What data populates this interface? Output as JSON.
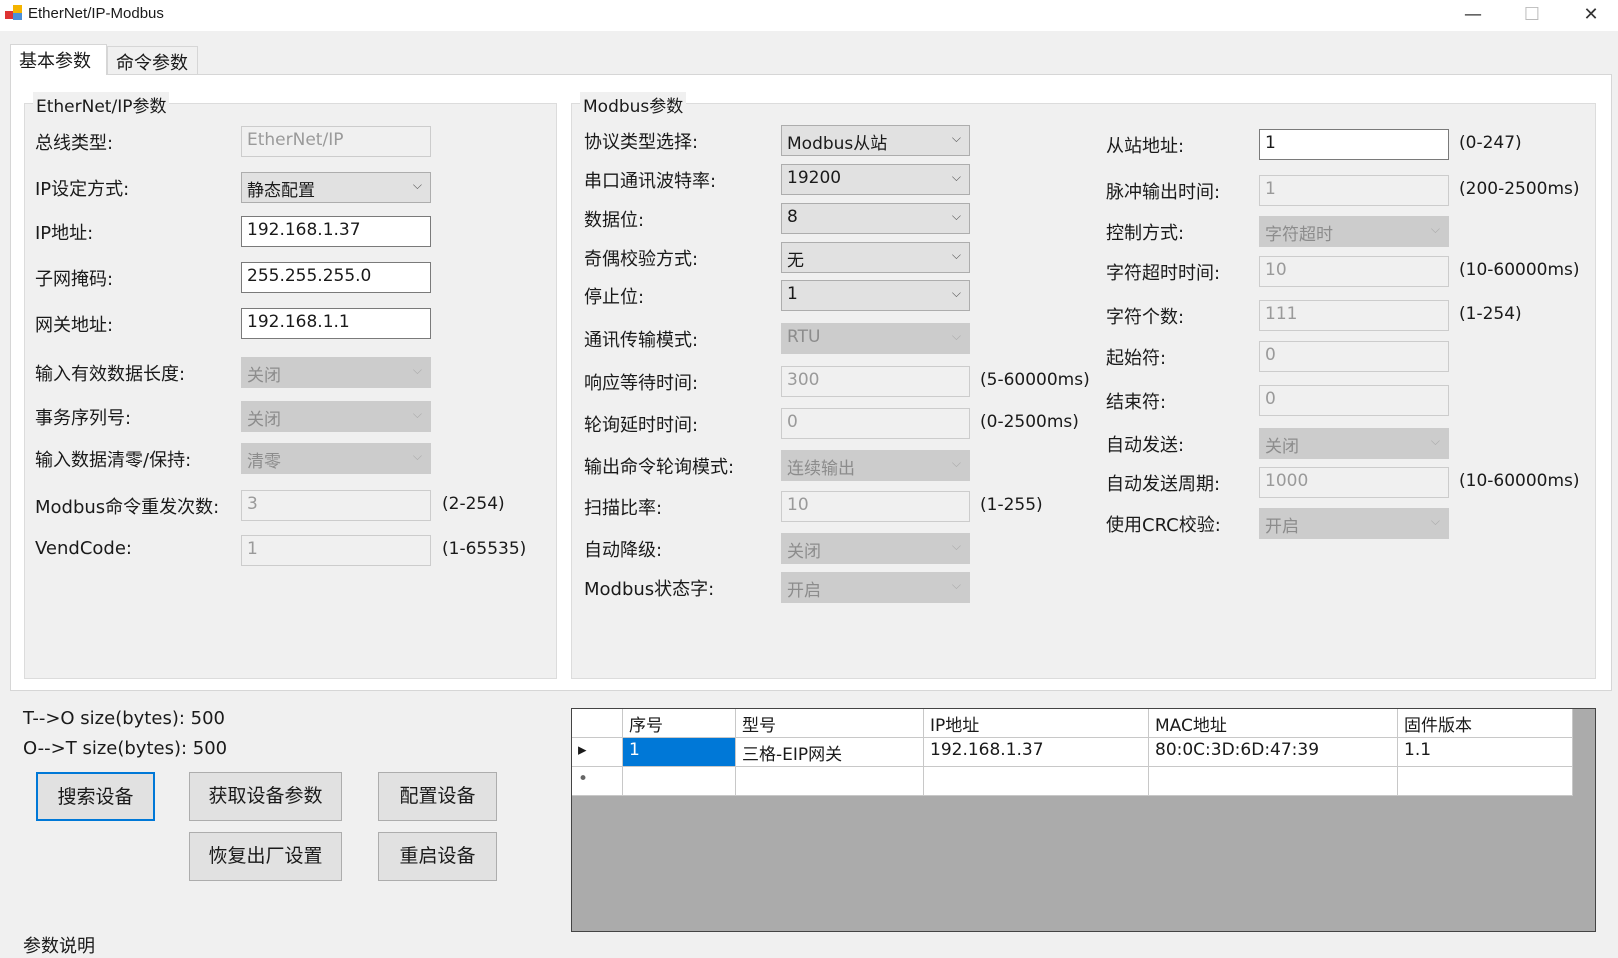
{
  "window": {
    "title": "EtherNet/IP-Modbus",
    "minimize": "—",
    "maximize": "☐",
    "close": "✕"
  },
  "tabs": [
    "基本参数",
    "命令参数"
  ],
  "eip": {
    "title": "EtherNet/IP参数",
    "rows": [
      {
        "label": "总线类型:",
        "value": "EtherNet/IP",
        "kind": "dis"
      },
      {
        "label": "IP设定方式:",
        "value": "静态配置",
        "kind": "sel"
      },
      {
        "label": "IP地址:",
        "value": "192.168.1.37",
        "kind": "txt"
      },
      {
        "label": "子网掩码:",
        "value": "255.255.255.0",
        "kind": "txt"
      },
      {
        "label": "网关地址:",
        "value": "192.168.1.1",
        "kind": "txt"
      },
      {
        "label": "输入有效数据长度:",
        "value": "关闭",
        "kind": "dsel"
      },
      {
        "label": "事务序列号:",
        "value": "关闭",
        "kind": "dsel"
      },
      {
        "label": "输入数据清零/保持:",
        "value": "清零",
        "kind": "dsel"
      },
      {
        "label": "Modbus命令重发次数:",
        "value": "3",
        "kind": "dis",
        "range": "(2-254)"
      },
      {
        "label": "VendCode:",
        "value": "1",
        "kind": "dis",
        "range": "(1-65535)"
      }
    ]
  },
  "modbus": {
    "title": "Modbus参数",
    "left": [
      {
        "label": "协议类型选择:",
        "value": "Modbus从站",
        "kind": "sel"
      },
      {
        "label": "串口通讯波特率:",
        "value": "19200",
        "kind": "sel"
      },
      {
        "label": "数据位:",
        "value": "8",
        "kind": "sel"
      },
      {
        "label": "奇偶校验方式:",
        "value": "无",
        "kind": "sel"
      },
      {
        "label": "停止位:",
        "value": "1",
        "kind": "sel"
      },
      {
        "label": "通讯传输模式:",
        "value": "RTU",
        "kind": "dsel"
      },
      {
        "label": "响应等待时间:",
        "value": "300",
        "kind": "dis",
        "range": "(5-60000ms)"
      },
      {
        "label": "轮询延时时间:",
        "value": "0",
        "kind": "dis",
        "range": "(0-2500ms)"
      },
      {
        "label": "输出命令轮询模式:",
        "value": "连续输出",
        "kind": "dsel"
      },
      {
        "label": "扫描比率:",
        "value": "10",
        "kind": "dis",
        "range": "(1-255)"
      },
      {
        "label": "自动降级:",
        "value": "关闭",
        "kind": "dsel"
      },
      {
        "label": "Modbus状态字:",
        "value": "开启",
        "kind": "dsel"
      }
    ],
    "right": [
      {
        "label": "从站地址:",
        "value": "1",
        "kind": "txt",
        "range": "(0-247)"
      },
      {
        "label": "脉冲输出时间:",
        "value": "1",
        "kind": "dis",
        "range": "(200-2500ms)"
      },
      {
        "label": "控制方式:",
        "value": "字符超时",
        "kind": "dsel"
      },
      {
        "label": "字符超时时间:",
        "value": "10",
        "kind": "dis",
        "range": "(10-60000ms)"
      },
      {
        "label": "字符个数:",
        "value": "111",
        "kind": "dis",
        "range": "(1-254)"
      },
      {
        "label": "起始符:",
        "value": "0",
        "kind": "dis"
      },
      {
        "label": "结束符:",
        "value": "0",
        "kind": "dis"
      },
      {
        "label": "自动发送:",
        "value": "关闭",
        "kind": "dsel"
      },
      {
        "label": "自动发送周期:",
        "value": "1000",
        "kind": "dis",
        "range": "(10-60000ms)"
      },
      {
        "label": "使用CRC校验:",
        "value": "开启",
        "kind": "dsel"
      }
    ]
  },
  "sizes": {
    "t_to_o": "T-->O size(bytes): 500",
    "o_to_t": "O-->T size(bytes): 500"
  },
  "buttons": {
    "search": "搜索设备",
    "get_params": "获取设备参数",
    "configure": "配置设备",
    "factory_reset": "恢复出厂设置",
    "restart": "重启设备"
  },
  "table": {
    "columns": [
      "序号",
      "型号",
      "IP地址",
      "MAC地址",
      "固件版本"
    ],
    "rows": [
      [
        "1",
        "三格-EIP网关",
        "192.168.1.37",
        "80:0C:3D:6D:47:39",
        "1.1"
      ]
    ]
  },
  "footer": "参数说明"
}
